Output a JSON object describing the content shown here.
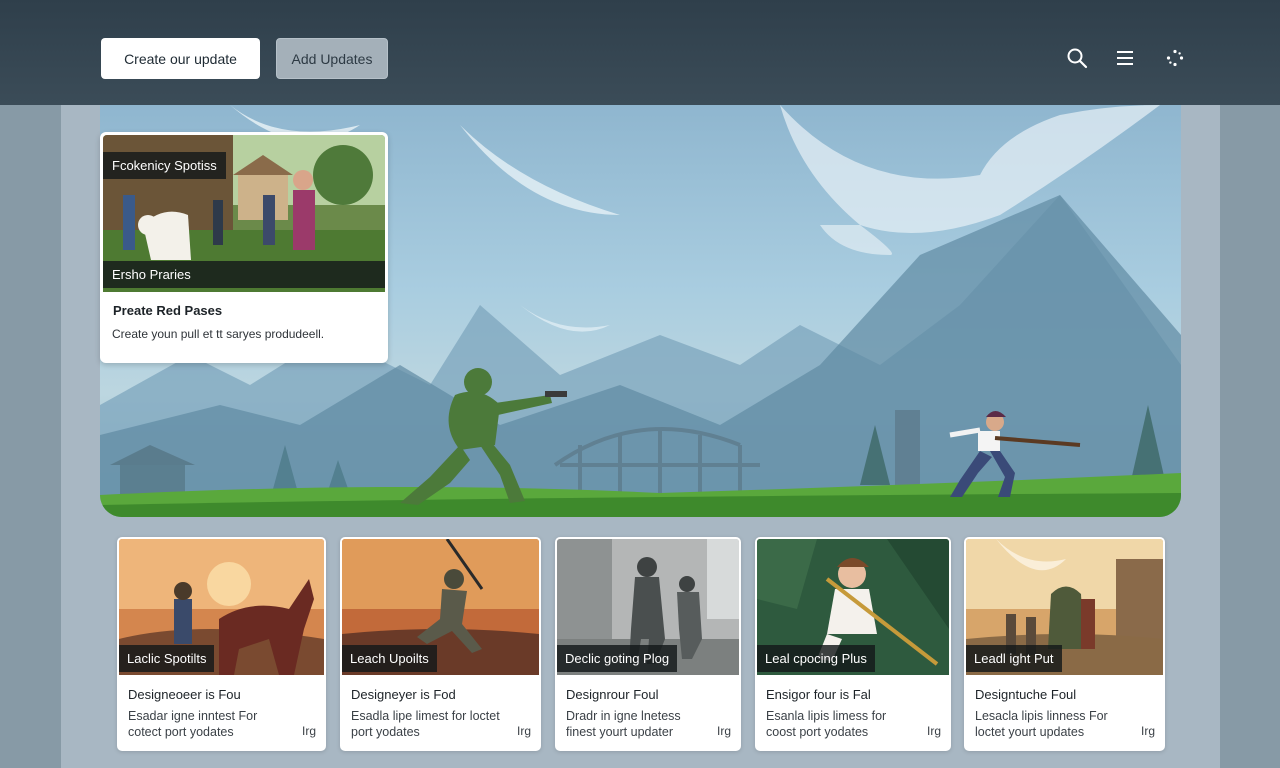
{
  "toolbar": {
    "create_label": "Create our update",
    "add_label": "Add Updates",
    "icons": [
      "search-icon",
      "list-icon",
      "loading-dots-icon"
    ]
  },
  "feature": {
    "tag_top": "Fcokenicy Spotiss",
    "tag_bottom": "Ersho Praries",
    "title": "Preate Red Pases",
    "description": "Create youn pull et tt saryes produdeell."
  },
  "cards": [
    {
      "tag": "Laclic Spotilts",
      "title": "Designeoeer is Fou",
      "desc": "Esadar igne inntest For cotect port yodates",
      "meta": "Irg"
    },
    {
      "tag": "Leach Upoilts",
      "title": "Designeyer is Fod",
      "desc": "Esadla lipe limest for loctet port yodates",
      "meta": "Irg"
    },
    {
      "tag": "Declic goting Plog",
      "title": "Designrour Foul",
      "desc": "Dradr in igne lnetess finest yourt updater",
      "meta": "Irg"
    },
    {
      "tag": "Leal cpocing Plus",
      "title": "Ensigor four is Fal",
      "desc": "Esanla lipis limess for coost port yodates",
      "meta": "Irg"
    },
    {
      "tag": "Leadl ight Put",
      "title": "Designtuche Foul",
      "desc": "Lesacla lipis linness For loctet yourt updates",
      "meta": "Irg"
    }
  ],
  "colors": {
    "topbar": "#34444f",
    "hero_sky": "#a9cde0",
    "grass": "#5aa83c"
  }
}
